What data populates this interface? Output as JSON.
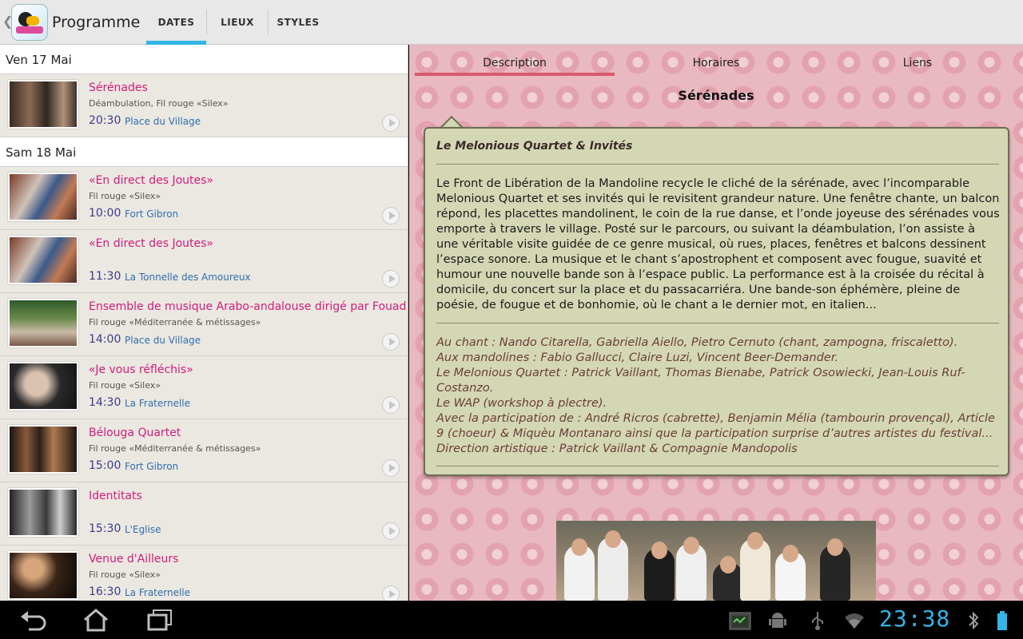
{
  "app": {
    "title": "Programme"
  },
  "tabs": [
    {
      "label": "DATES"
    },
    {
      "label": "LIEUX"
    },
    {
      "label": "STYLES"
    }
  ],
  "days": [
    {
      "header": "Ven 17 Mai"
    },
    {
      "header": "Sam 18 Mai"
    }
  ],
  "events": [
    {
      "title": "Sérénades",
      "subtitle": "Déambulation, Fil rouge «Silex»",
      "time": "20:30",
      "place": "Place du Village"
    },
    {
      "title": "«En direct des Joutes»",
      "subtitle": "Fil rouge «Silex»",
      "time": "10:00",
      "place": "Fort Gibron"
    },
    {
      "title": "«En direct des Joutes»",
      "subtitle": "",
      "time": "11:30",
      "place": "La Tonnelle des Amoureux"
    },
    {
      "title": "Ensemble de musique Arabo-andalouse dirigé par Fouad Didi",
      "subtitle": "Fil rouge «Méditerranée & métissages»",
      "time": "14:00",
      "place": "Place du Village"
    },
    {
      "title": "«Je vous réfléchis»",
      "subtitle": "Fil rouge «Silex»",
      "time": "14:30",
      "place": "La Fraternelle"
    },
    {
      "title": "Bélouga Quartet",
      "subtitle": "Fil rouge «Méditerranée & métissages»",
      "time": "15:00",
      "place": "Fort Gibron"
    },
    {
      "title": "Identitats",
      "subtitle": "",
      "time": "15:30",
      "place": "L'Eglise"
    },
    {
      "title": "Venue d'Ailleurs",
      "subtitle": "Fil rouge «Silex»",
      "time": "16:30",
      "place": "La Fraternelle"
    }
  ],
  "detail": {
    "tabs": [
      {
        "label": "Description"
      },
      {
        "label": "Horaires"
      },
      {
        "label": "Liens"
      }
    ],
    "title": "Sérénades",
    "subtitle": "Le Melonious Quartet & Invités",
    "body": "Le Front de Libération de la Mandoline recycle le cliché de la sérénade, avec l’incomparable Melonious Quartet et ses invités qui le revisitent grandeur nature. Une fenêtre chante, un balcon répond, les placettes mandolinent, le coin de la rue danse, et l’onde joyeuse des sérénades vous emporte à travers le village. Posté sur le parcours, ou suivant la déambulation, l’on assiste à une véritable visite guidée de ce genre musical, où rues, places, fenêtres et balcons dessinent l’espace sonore. La musique et le chant s’apostrophent et composent avec fougue, suavité et humour une nouvelle bande son à l’espace public. La performance est à la croisée du récital à domicile, du concert sur la place et du passacarriéra. Une bande-son éphémère, pleine de poésie, de fougue et de bonhomie, où le chant a le dernier mot, en italien...",
    "credits": [
      "Au chant : Nando Citarella, Gabriella Aiello, Pietro Cernuto (chant, zampogna, friscaletto).",
      "Aux mandolines : Fabio Gallucci, Claire Luzi, Vincent Beer-Demander.",
      "Le Melonious Quartet : Patrick Vaillant, Thomas Bienabe, Patrick Osowiecki, Jean-Louis Ruf-Costanzo.",
      "Le WAP (workshop à plectre).",
      "Avec la participation de : André Ricros (cabrette), Benjamin Mélia (tambourin provençal), Article 9 (choeur) & Miquèu Montanaro ainsi que la participation surprise d’autres artistes du festival...",
      "Direction artistique : Patrick Vaillant & Compagnie Mandopolis"
    ]
  },
  "status": {
    "clock": "23:38"
  },
  "colors": {
    "accent": "#33b5e5",
    "title_pink": "#d01c7c",
    "card_bg": "#d4d7b3"
  }
}
